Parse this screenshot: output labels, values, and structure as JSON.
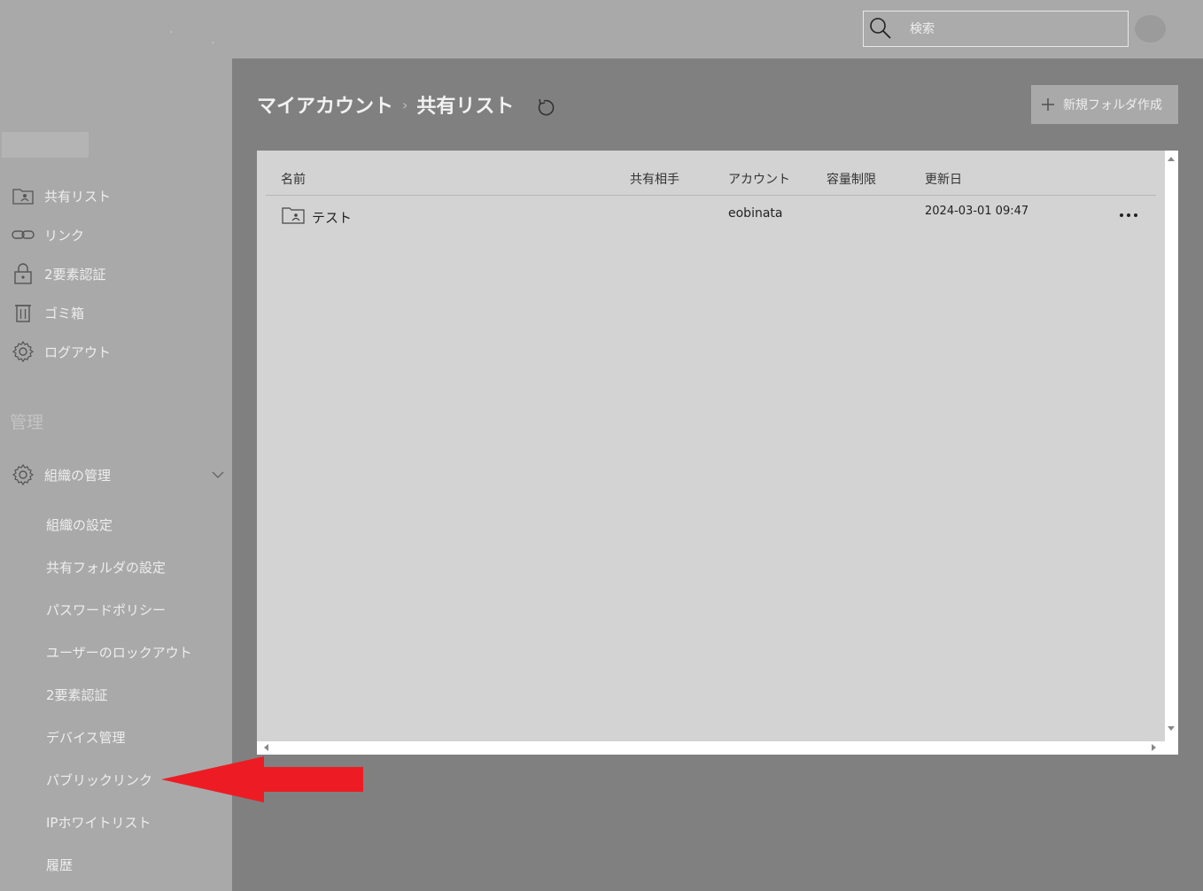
{
  "search": {
    "placeholder": "検索"
  },
  "sidebar": {
    "items": [
      {
        "label": "共有リスト",
        "icon": "shared-folder-icon"
      },
      {
        "label": "リンク",
        "icon": "link-icon"
      },
      {
        "label": "2要素認証",
        "icon": "lock-icon"
      },
      {
        "label": "ゴミ箱",
        "icon": "trash-icon"
      },
      {
        "label": "ログアウト",
        "icon": "gear-icon"
      }
    ],
    "section_label": "管理",
    "admin": {
      "label": "組織の管理",
      "icon": "gear-icon",
      "sub_items": [
        "組織の設定",
        "共有フォルダの設定",
        "パスワードポリシー",
        "ユーザーのロックアウト",
        "2要素認証",
        "デバイス管理",
        "パブリックリンク",
        "IPホワイトリスト",
        "履歴"
      ]
    }
  },
  "breadcrumb": {
    "root": "マイアカウント",
    "separator": "›",
    "current": "共有リスト"
  },
  "toolbar": {
    "new_folder_label": "新規フォルダ作成"
  },
  "table": {
    "columns": [
      "名前",
      "共有相手",
      "アカウント",
      "容量制限",
      "更新日"
    ],
    "rows": [
      {
        "name": "テスト",
        "shared_with": "",
        "account": "eobinata",
        "quota": "",
        "updated": "2024-03-01 09:47"
      }
    ]
  },
  "colors": {
    "annotation_arrow": "#ed1c24",
    "sidebar_bg": "#a9a9a9",
    "main_bg": "#808080"
  }
}
